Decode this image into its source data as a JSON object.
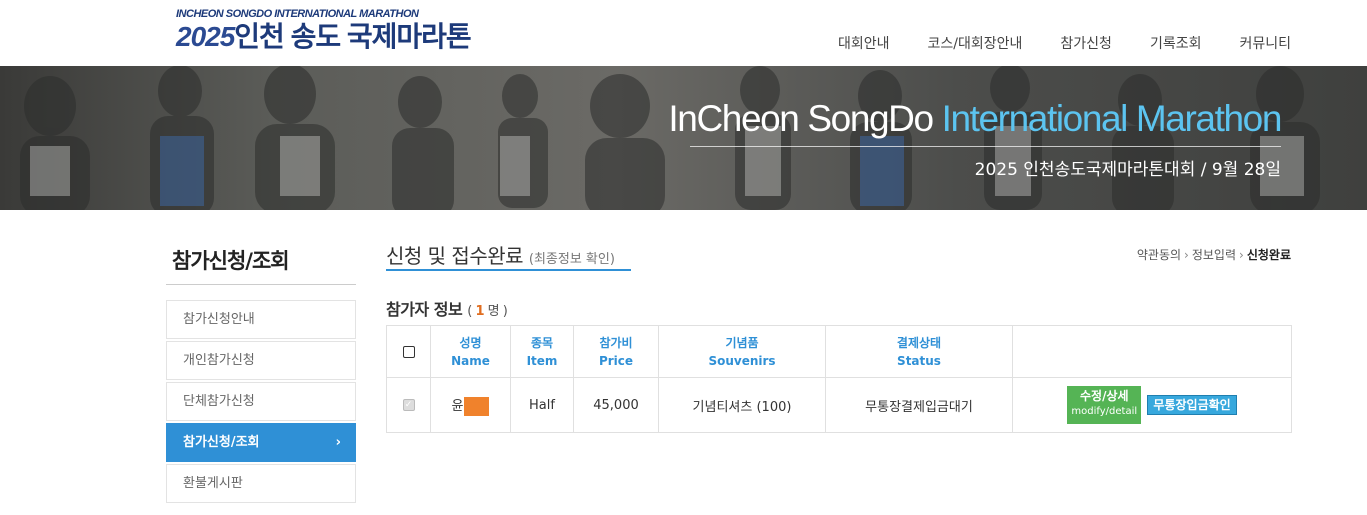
{
  "header": {
    "logo_en": "INCHEON SONGDO INTERNATIONAL MARATHON",
    "logo_year": "2025",
    "logo_kr": "인천 송도 국제마라톤",
    "nav": [
      "대회안내",
      "코스/대회장안내",
      "참가신청",
      "기록조회",
      "커뮤니티"
    ]
  },
  "banner": {
    "title_part1": "InCheon SongDo ",
    "title_part2": "International Marathon",
    "subtitle": "2025 인천송도국제마라톤대회 / 9월 28일"
  },
  "sidebar": {
    "title": "참가신청/조회",
    "items": [
      {
        "label": "참가신청안내",
        "active": false
      },
      {
        "label": "개인참가신청",
        "active": false
      },
      {
        "label": "단체참가신청",
        "active": false
      },
      {
        "label": "참가신청/조회",
        "active": true
      },
      {
        "label": "환불게시판",
        "active": false
      }
    ],
    "active_arrow": "›"
  },
  "content": {
    "title": "신청 및 접수완료",
    "title_sub": "(최종정보 확인)",
    "breadcrumb": [
      "약관동의",
      "정보입력",
      "신청완료"
    ],
    "breadcrumb_sep": "›",
    "section_title": "참가자 정보",
    "section_open": "(",
    "count": "1",
    "count_unit": "명 )"
  },
  "table": {
    "headers": [
      {
        "kr": "성명",
        "en": "Name"
      },
      {
        "kr": "종목",
        "en": "Item"
      },
      {
        "kr": "참가비",
        "en": "Price"
      },
      {
        "kr": "기념품",
        "en": "Souvenirs"
      },
      {
        "kr": "결제상태",
        "en": "Status"
      }
    ],
    "row": {
      "name": "윤",
      "item": "Half",
      "price": "45,000",
      "souvenir": "기념티셔츠 (100)",
      "status": "무통장결제입금대기",
      "modify_label": "수정/상세",
      "modify_sub": "modify/detail",
      "confirm_label": "무통장입금확인"
    }
  },
  "colors": {
    "accent": "#2f90d6",
    "count": "#e06d1f",
    "mask": "#f0822c",
    "btn_green": "#55b455",
    "btn_blue": "#37a8dd"
  }
}
